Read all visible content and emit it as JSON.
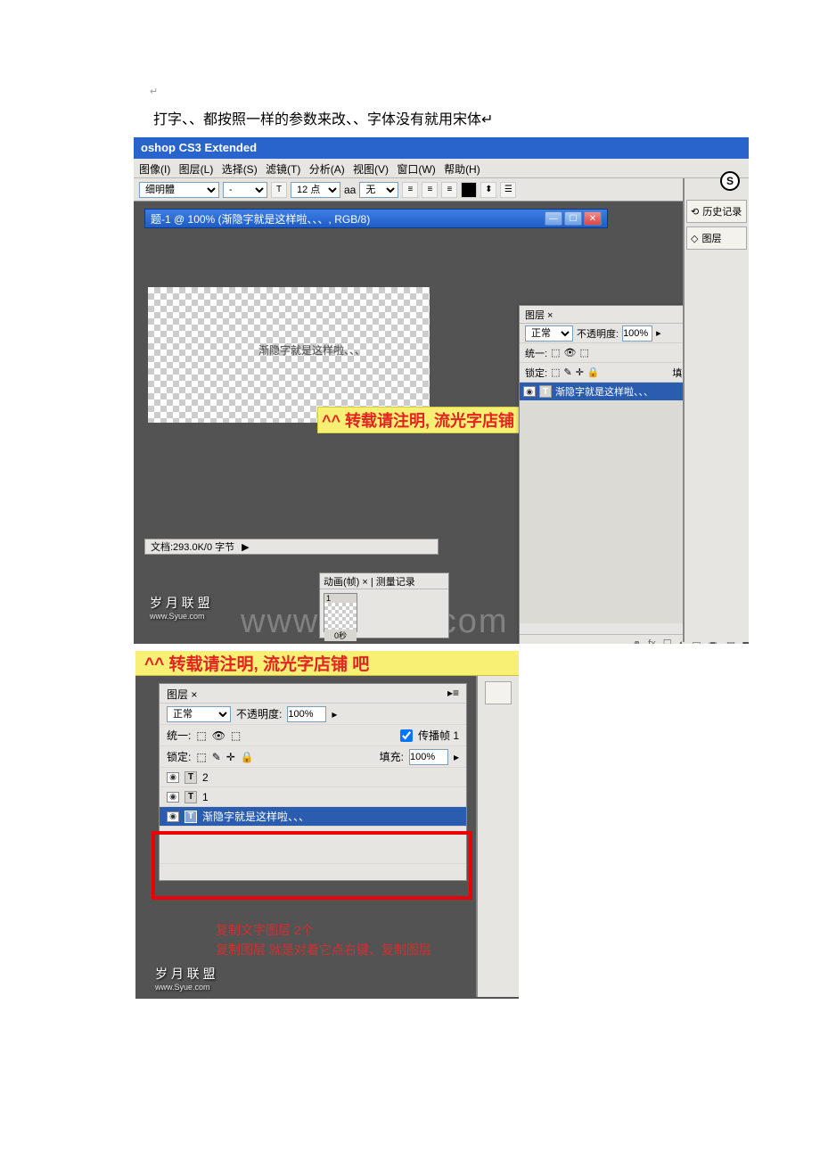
{
  "doc": {
    "marker": "↵",
    "line1": "打字、、都按照一样的参数来改、、字体没有就用宋体↵"
  },
  "app": {
    "title": "oshop CS3 Extended"
  },
  "menu": {
    "image": "图像(I)",
    "layer": "图层(L)",
    "select": "选择(S)",
    "filter": "滤镜(T)",
    "analysis": "分析(A)",
    "view": "视图(V)",
    "window": "窗口(W)",
    "help": "帮助(H)"
  },
  "toolbar": {
    "font_family": "细明體",
    "font_style": "-",
    "T": "T",
    "size": "12 点",
    "aa_label": "aa",
    "aa_value": "无"
  },
  "docwin": {
    "title": "题-1 @ 100% (渐隐字就是这样啦、、、, RGB/8)"
  },
  "canvas_text": "渐隐字就是这样啦、、、",
  "overlay": "^^ 转载请注明, 流光字店铺   吧",
  "status": {
    "doc": "文档:293.0K/0 字节",
    "arrow": "▶"
  },
  "layers": {
    "tab": "图层 ×",
    "mode": "正常",
    "opacity_label": "不透明度:",
    "opacity_value": "100%",
    "unify": "统一:",
    "propagate": "传播帧 1",
    "lock": "锁定:",
    "fill_label": "填充:",
    "fill_value": "100%",
    "item_text": "渐隐字就是这样啦、、、"
  },
  "layers2": {
    "tab": "图层 ×",
    "mode": "正常",
    "opacity_label": "不透明度:",
    "opacity_value": "100%",
    "unify": "统一:",
    "propagate": "传播帧 1",
    "lock": "锁定:",
    "fill_label": "填充:",
    "fill_value": "100%",
    "items": [
      {
        "label": "2"
      },
      {
        "label": "1"
      },
      {
        "label": "渐隐字就是这样啦、、、"
      }
    ]
  },
  "sidepanel": {
    "history": "历史记录",
    "layers": "图层",
    "S": "S"
  },
  "anim": {
    "tabs": "动画(帧) × | 测量记录",
    "frame_no": "1",
    "time": "0秒"
  },
  "watermark_big": "www.bdocx.com",
  "logo": {
    "name": "岁 月 联 盟",
    "url": "www.Syue.com"
  },
  "overlay2": "^^ 转载请注明, 流光字店铺   吧",
  "note": {
    "line1": "复制文字图层   2个",
    "line2": "复制图层   就是对着它点右键、复制图层"
  }
}
